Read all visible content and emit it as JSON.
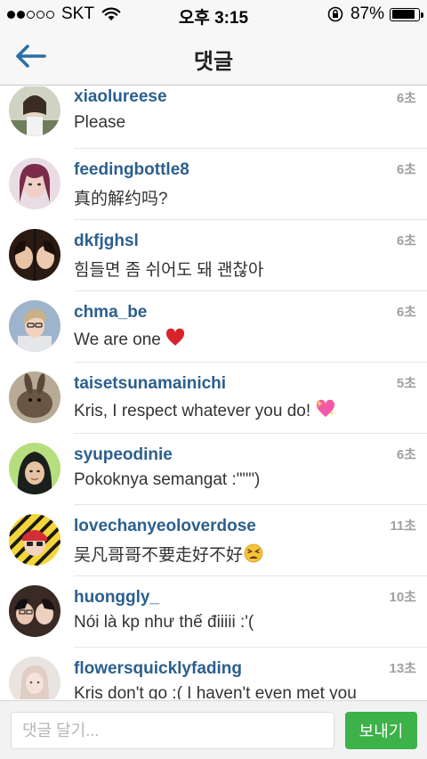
{
  "status_bar": {
    "carrier": "SKT",
    "time": "오후 3:15",
    "battery_pct": "87%",
    "battery_level": 0.87,
    "signal_bars": 2
  },
  "nav": {
    "title": "댓글",
    "back_icon": "back-arrow-icon"
  },
  "comments": [
    {
      "username": "xiaolureese",
      "text": "Please",
      "time": "6초",
      "emoji": ""
    },
    {
      "username": "feedingbottle8",
      "text": "真的解约吗?",
      "time": "6초",
      "emoji": ""
    },
    {
      "username": "dkfjghsl",
      "text": "힘들면 좀 쉬어도 돼 괜찮아",
      "time": "6초",
      "emoji": ""
    },
    {
      "username": "chma_be",
      "text": "We are one",
      "time": "6초",
      "emoji": "red-heart"
    },
    {
      "username": "taisetsunamainichi",
      "text": "Kris, I respect whatever you do!",
      "time": "5초",
      "emoji": "sparkling-heart"
    },
    {
      "username": "syupeodinie",
      "text": "Pokoknya semangat :\"\"\")",
      "time": "6초",
      "emoji": ""
    },
    {
      "username": "lovechanyeoloverdose",
      "text": "吴凡哥哥不要走好不好",
      "time": "11초",
      "emoji": "tired-face"
    },
    {
      "username": "huonggly_",
      "text": "Nói là kp như thế điiiii :'(",
      "time": "10초",
      "emoji": ""
    },
    {
      "username": "flowersquicklyfading",
      "text": "Kris don't go :( I haven't even met you",
      "time": "13초",
      "emoji": ""
    }
  ],
  "input": {
    "placeholder": "댓글 달기...",
    "value": "",
    "send_label": "보내기"
  },
  "colors": {
    "username": "#2c5f8e",
    "nav_arrow": "#2c6ea3",
    "send_button": "#3cb248"
  }
}
